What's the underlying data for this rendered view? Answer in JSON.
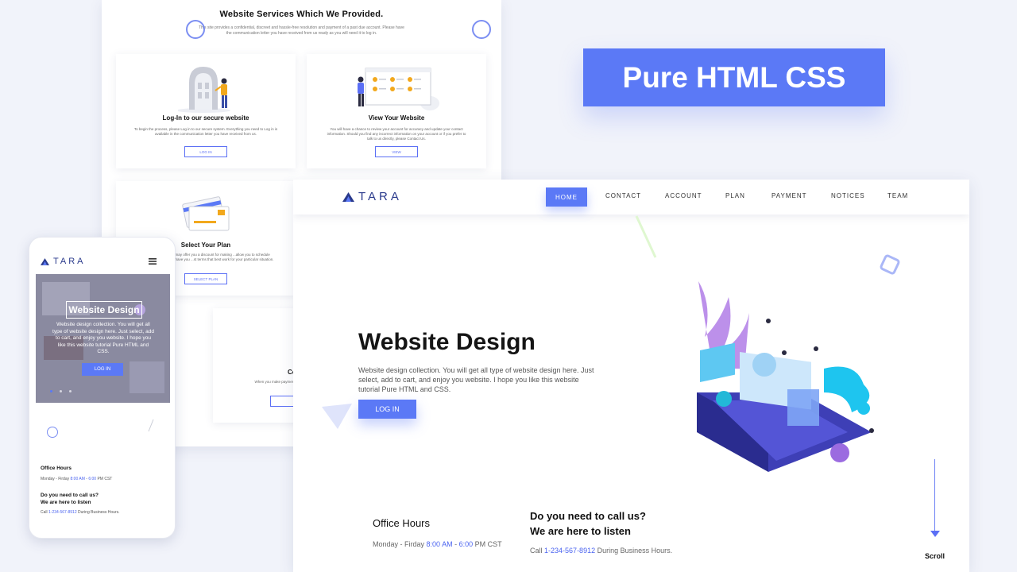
{
  "services": {
    "title": "Website Services Which We Provided.",
    "description": "This site provides a confidential, discreet and hassle-free resolution and payment of a past due account. Please have the communication letter you have received from us ready as you will need it to log in.",
    "cards": [
      {
        "title": "Log-In to our secure website",
        "text": "To begin the process, please Log in to our secure system. Everything you need to Log in is available in the communication letter you have received from us.",
        "button": "LOG IN"
      },
      {
        "title": "View Your Website",
        "text": "You will have a chance to review your account for accuracy and update your contact information. Should you find any incorrect information on your account or if you prefer to talk to us directly, please Contact Us.",
        "button": "VIEW"
      },
      {
        "title": "Select Your Plan",
        "text": "...payment in full, we may offer you a discount for making ...allow you to schedule payments over time, or have you ...st terms that best work for your particular situation.",
        "button": "SELECT PLAN"
      },
      {
        "title": "Confirm Y",
        "text": "When you make payment(s), we w... also log in any time to..."
      }
    ]
  },
  "label": "Pure HTML CSS",
  "desktop": {
    "logo": "TARA",
    "nav": [
      "HOME",
      "CONTACT",
      "ACCOUNT",
      "PLAN",
      "PAYMENT",
      "NOTICES",
      "TEAM"
    ],
    "hero": {
      "title": "Website Design",
      "text": "Website design collection. You will get all type of website design here. Just select, add to cart, and enjoy you website. I hope you like this website tutorial Pure HTML and CSS.",
      "button": "LOG IN"
    },
    "office": {
      "title": "Office Hours",
      "days": "Monday - Firday",
      "open": "8:00 AM",
      "dash": "-",
      "close": "6:00",
      "tz": "PM CST"
    },
    "call": {
      "line1": "Do you need to call us?",
      "line2": "We are here to listen",
      "prefix": "Call",
      "phone": "1-234-567-8912",
      "suffix": "During Business Hours."
    },
    "scroll": "Scroll"
  },
  "mobile": {
    "logo": "TARA",
    "hero_title": "Website Design",
    "hero_text": "Website design collection. You will get all type of website design here. Just select, add to cart, and enjoy you website. I hope you like this website tutorial Pure HTML and CSS.",
    "hero_button": "LOG IN",
    "office_title": "Office Hours",
    "days": "Monday - Firday",
    "open": "8:00 AM",
    "dash": "-",
    "close": "6:00",
    "tz": "PM CST",
    "call_line1": "Do you need to call us?",
    "call_line2": "We are here to listen",
    "call_prefix": "Call",
    "call_phone": "1-234-567-8912",
    "call_suffix": "During Business Hours."
  },
  "colors": {
    "accent": "#5b79f6",
    "brand": "#2a3a8c",
    "background": "#f1f3fa"
  }
}
